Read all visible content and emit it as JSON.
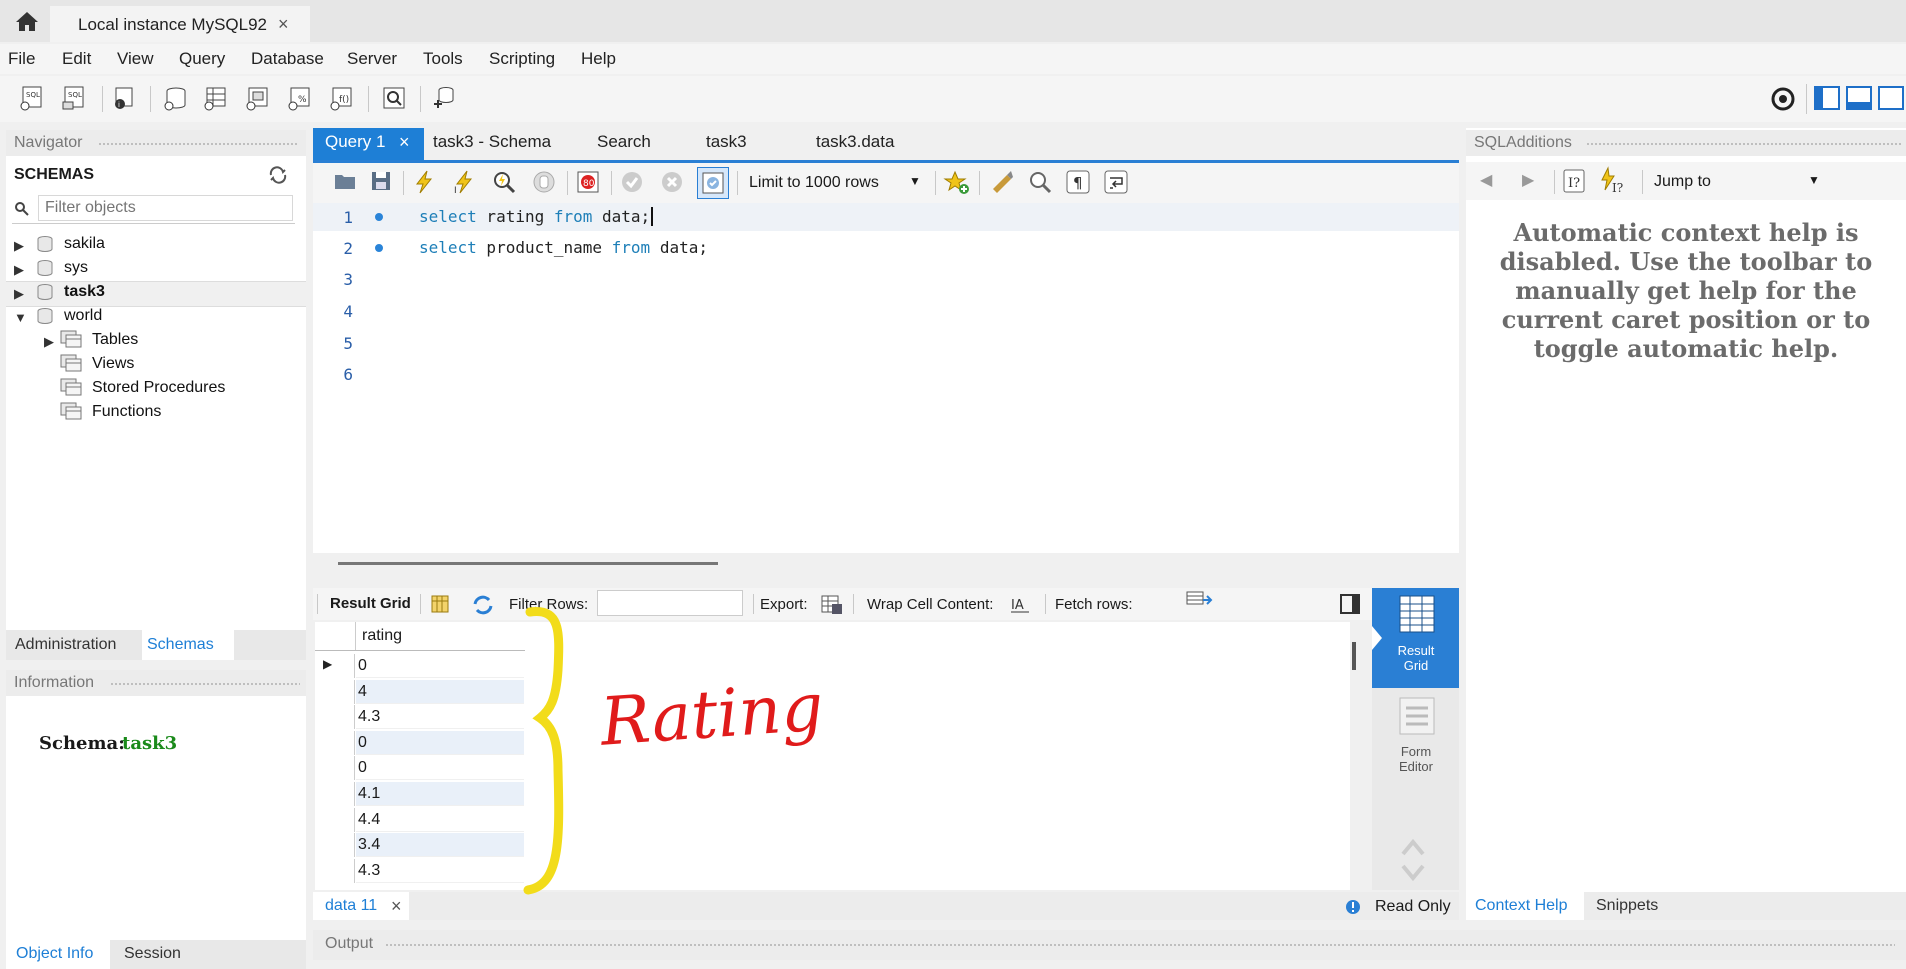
{
  "window": {
    "tab_title": "Local instance MySQL92",
    "tab_close": "×"
  },
  "menu": [
    "File",
    "Edit",
    "View",
    "Query",
    "Database",
    "Server",
    "Tools",
    "Scripting",
    "Help"
  ],
  "navigator": {
    "header": "Navigator",
    "schemas_title": "SCHEMAS",
    "filter_placeholder": "Filter objects",
    "schemas": [
      "sakila",
      "sys",
      "task3",
      "world"
    ],
    "world_children": [
      "Tables",
      "Views",
      "Stored Procedures",
      "Functions"
    ],
    "tabs": [
      "Administration",
      "Schemas"
    ]
  },
  "information": {
    "header": "Information",
    "schema_label": "Schema:",
    "schema_value": "task3",
    "tabs": [
      "Object Info",
      "Session"
    ]
  },
  "editor": {
    "tabs": [
      "Query 1",
      "task3 - Schema",
      "Search",
      "task3",
      "task3.data"
    ],
    "active_close": "×",
    "limit_select": "Limit to 1000 rows",
    "line_numbers": [
      "1",
      "2",
      "3",
      "4",
      "5",
      "6"
    ],
    "lines": [
      {
        "kw1": "select",
        "t1": " rating ",
        "kw2": "from",
        "t2": " data;"
      },
      {
        "kw1": "select",
        "t1": " product_name ",
        "kw2": "from",
        "t2": " data;"
      }
    ]
  },
  "results": {
    "result_grid": "Result Grid",
    "filter_rows": "Filter Rows:",
    "export": "Export:",
    "wrap": "Wrap Cell Content:",
    "fetch": "Fetch rows:",
    "column": "rating",
    "rows": [
      "0",
      "4",
      "4.3",
      "0",
      "0",
      "4.1",
      "4.4",
      "3.4",
      "4.3"
    ],
    "side_result_grid": "Result Grid",
    "side_form_editor": "Form Editor",
    "tab": "data 11",
    "tab_close": "×",
    "read_only": "Read Only"
  },
  "output": {
    "header": "Output"
  },
  "sql_additions": {
    "header": "SQLAdditions",
    "jump_to": "Jump to",
    "help_text": "Automatic context help is disabled. Use the toolbar to manually get help for the current caret position or to toggle automatic help.",
    "tabs": [
      "Context Help",
      "Snippets"
    ]
  },
  "annotation": {
    "text": "Rating",
    "color": "#e01b1b",
    "brace_color": "#f2dc1a"
  },
  "colors": {
    "accent": "#1e7fd6",
    "schema_green": "#1a8a1a",
    "keyword": "#1e7fb8"
  }
}
